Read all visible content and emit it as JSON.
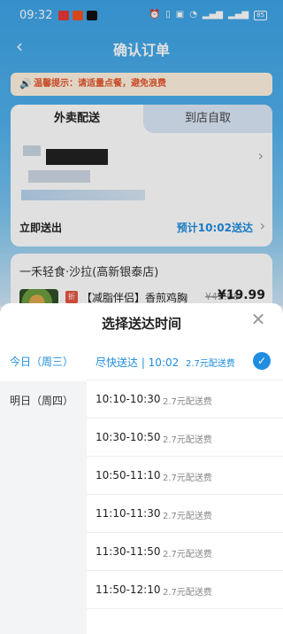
{
  "status_bar": {
    "time": "09:32",
    "app_icons": [
      {
        "name": "app-icon-1",
        "color": "#e53935"
      },
      {
        "name": "weibo-icon",
        "color": "#f4511e"
      },
      {
        "name": "tiktok-icon",
        "color": "#111111"
      }
    ],
    "right_icons": [
      "alarm-icon",
      "vibrate-icon",
      "hd-icon",
      "wifi-icon",
      "signal-icon",
      "signal-icon"
    ],
    "battery": "85"
  },
  "nav": {
    "title": "确认订单"
  },
  "tip": {
    "text": "温馨提示：请适量点餐，避免浪费"
  },
  "delivery_tabs": [
    "外卖配送",
    "到店自取"
  ],
  "delivery": {
    "label": "立即送出",
    "eta": "预计10:02送达"
  },
  "shop": {
    "name": "一禾轻食·沙拉(高新银泰店)",
    "dish": {
      "tag": "折",
      "name": "【减脂伴侣】香煎鸡胸",
      "old_price": "¥42.98",
      "price": "¥19.99"
    }
  },
  "sheet": {
    "title": "选择送达时间",
    "days": [
      {
        "label": "今日（周三）",
        "active": true
      },
      {
        "label": "明日（周四）",
        "active": false
      }
    ],
    "slots": [
      {
        "time": "尽快送达 | 10:02",
        "fee": "2.7元配送费",
        "selected": true
      },
      {
        "time": "10:10-10:30",
        "fee": "2.7元配送费",
        "selected": false
      },
      {
        "time": "10:30-10:50",
        "fee": "2.7元配送费",
        "selected": false
      },
      {
        "time": "10:50-11:10",
        "fee": "2.7元配送费",
        "selected": false
      },
      {
        "time": "11:10-11:30",
        "fee": "2.7元配送费",
        "selected": false
      },
      {
        "time": "11:30-11:50",
        "fee": "2.7元配送费",
        "selected": false
      },
      {
        "time": "11:50-12:10",
        "fee": "2.7元配送费",
        "selected": false
      }
    ]
  },
  "colors": {
    "accent": "#1f8de0",
    "header": "#3da3e6",
    "warning": "#e4572e"
  }
}
